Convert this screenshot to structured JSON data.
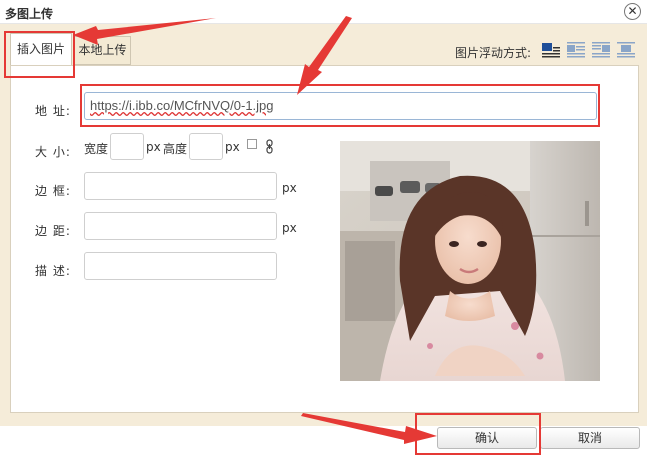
{
  "window": {
    "title": "多图上传",
    "close_glyph": "✕"
  },
  "tabs": [
    {
      "label": "插入图片",
      "active": true
    },
    {
      "label": "本地上传",
      "active": false
    }
  ],
  "float_mode": {
    "label": "图片浮动方式:",
    "options": [
      "none-icon",
      "left-icon",
      "center-icon",
      "right-icon"
    ],
    "selected": 0
  },
  "form": {
    "address_label": "地 址:",
    "address_value": "https://i.ibb.co/MCfrNVQ/0-1.jpg",
    "size_label": "大 小:",
    "width_label": "宽度",
    "height_label": "高度",
    "px": "px",
    "border_label": "边 框:",
    "margin_label": "边 距:",
    "desc_label": "描 述:"
  },
  "buttons": {
    "confirm": "确认",
    "cancel": "取消"
  },
  "colors": {
    "accent_red": "#e53935",
    "dialog_bg": "#f5ecd9"
  }
}
